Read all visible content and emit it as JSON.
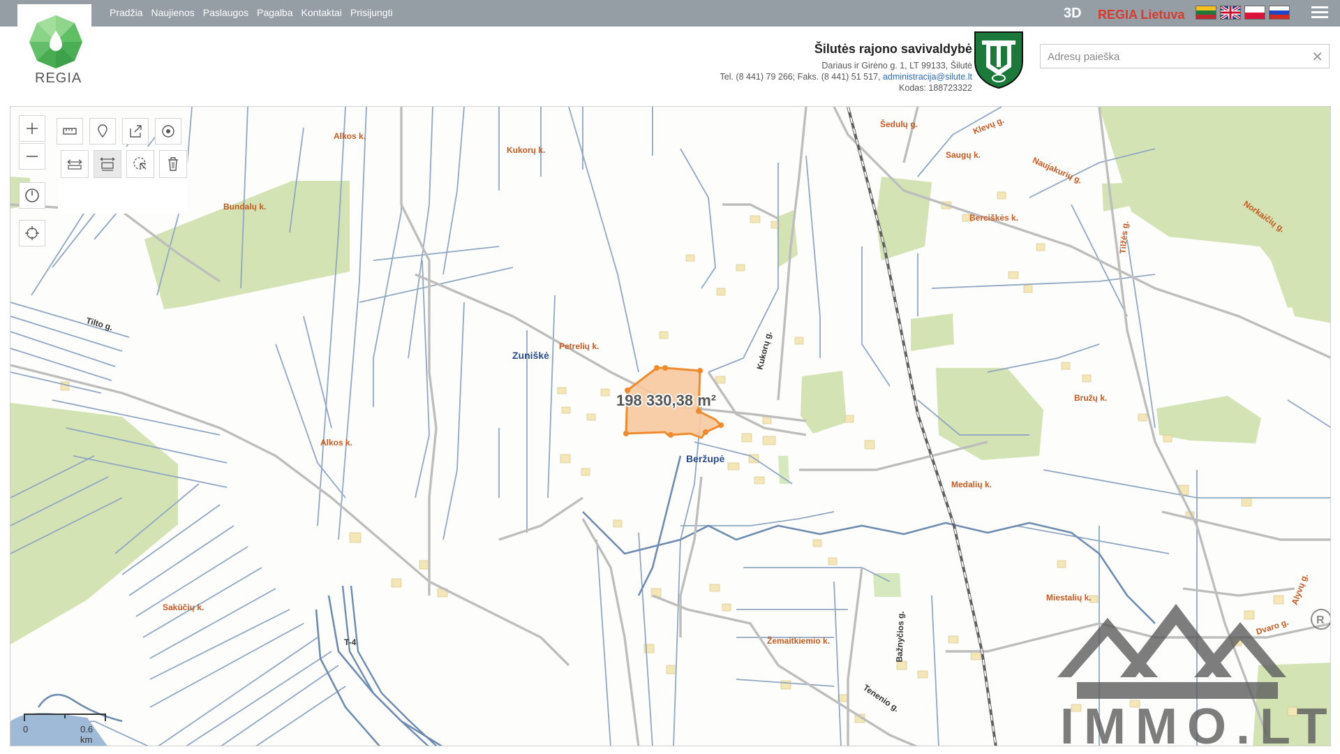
{
  "nav": {
    "items": [
      "Pradžia",
      "Naujienos",
      "Paslaugos",
      "Pagalba",
      "Kontaktai",
      "Prisijungti"
    ],
    "mode_3d": "3D",
    "regia_lietuva": "REGIA Lietuva",
    "languages": [
      "lt-flag-icon",
      "gb-flag-icon",
      "pl-flag-icon",
      "ru-flag-icon"
    ],
    "menu_icon": "hamburger-menu-icon"
  },
  "logo": {
    "text": "REGIA",
    "color": "#5dbb63"
  },
  "municipality": {
    "name": "Šilutės rajono savivaldybė",
    "address": "Dariaus ir Girėno g. 1, LT 99133, Šilutė",
    "phone_prefix": "Tel. (8 441) 79 266; Faks. (8 441) 51 517, ",
    "email": "administracija@silute.lt",
    "code": "Kodas: 188723322"
  },
  "search": {
    "placeholder": "Adresų paieška",
    "value": ""
  },
  "map": {
    "area_measurement": "198 330,38 m²",
    "scale": {
      "start": "0",
      "end": "0.6 km"
    },
    "places": [
      "Alkos k.",
      "Kukorų k.",
      "Šedulų g.",
      "Klevų g.",
      "Saugų k.",
      "Naujakurių g.",
      "Bundalų k.",
      "Berciškės k.",
      "Norkaičių g.",
      "Tilžės g.",
      "Petrelių k.",
      "Bružų k.",
      "Alkos k.",
      "Medalių k.",
      "Miestalių k.",
      "Sakūčių k.",
      "Žemaitkiemio k.",
      "Dvaro g.",
      "Alyvų g."
    ],
    "roads": [
      "Tilto g.",
      "Kukorų g.",
      "Bažnyčios g.",
      "Tenenio g.",
      "T-4"
    ],
    "villages": [
      "Zuniškė",
      "Beržupė"
    ],
    "watermark": "IMMO.LT",
    "colors": {
      "forest": "#d3e3b3",
      "parcel": "#f7c9a0",
      "parcel_border": "#f08a2a",
      "canal": "#8fa7c2",
      "road": "#bdbdbd"
    }
  },
  "tools": [
    "zoom-in-icon",
    "zoom-out-icon",
    "history-icon",
    "locate-icon",
    "measure-icon",
    "pin-icon",
    "export-icon",
    "target-icon",
    "measure-distance-icon",
    "measure-area-icon",
    "select-tool-icon",
    "trash-icon"
  ]
}
